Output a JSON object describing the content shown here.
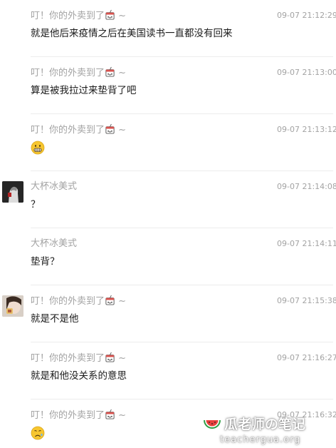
{
  "messages": [
    {
      "sender": "叮！你的外卖到了",
      "suffix": "~",
      "time": "09-07 21:12:29",
      "text": "就是他后来疫情之后在美国读书一直都没有回来"
    },
    {
      "sender": "叮！你的外卖到了",
      "suffix": "~",
      "time": "09-07 21:13:00",
      "text": "算是被我拉过来垫背了吧"
    },
    {
      "sender": "叮！你的外卖到了",
      "suffix": "~",
      "time": "09-07 21:13:12",
      "emoji": "grimacing-face-emoji"
    },
    {
      "sender": "大杯冰美式",
      "time": "09-07 21:14:08",
      "text": "？"
    },
    {
      "sender": "大杯冰美式",
      "time": "09-07 21:14:11",
      "text": "垫背？"
    },
    {
      "sender": "叮！你的外卖到了",
      "suffix": "~",
      "time": "09-07 21:15:38",
      "text": "就是不是他"
    },
    {
      "sender": "叮！你的外卖到了",
      "suffix": "~",
      "time": "09-07 21:16:27",
      "text": "就是和他没关系的意思"
    },
    {
      "sender": "叮！你的外卖到了",
      "suffix": "~",
      "time": "09-07 21:16:32",
      "emoji": "sad-face-emoji"
    }
  ],
  "watermark": {
    "title": "瓜老师の笔记",
    "url": "teachergua.org"
  },
  "colors": {
    "meta_text": "#a3a3a3",
    "message_text": "#1a1a1a",
    "divider": "#ececec",
    "emoji_yellow": "#f7c62f",
    "cup_red": "#d9534f"
  },
  "icons": {
    "sender_badge": "bubble-tea-cup-icon",
    "watermark_logo": "watermelon-icon"
  }
}
